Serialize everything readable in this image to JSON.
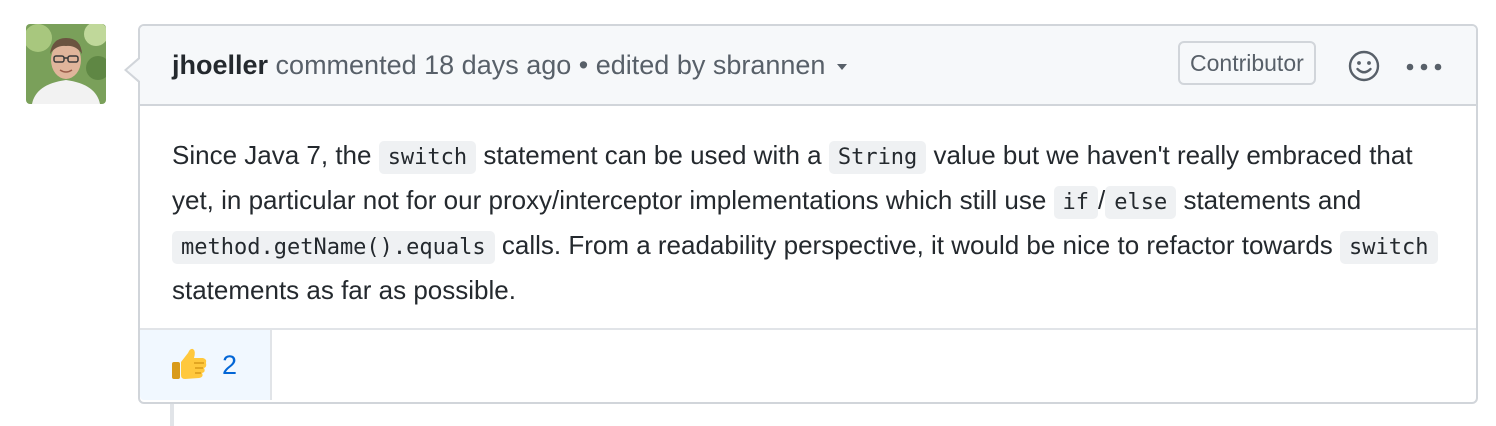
{
  "comment": {
    "author": "jhoeller",
    "action": "commented",
    "time": "18 days ago",
    "separator": "•",
    "edited_by_prefix": "edited by",
    "editor": "sbrannen",
    "role_badge": "Contributor",
    "icons": {
      "reaction": "smiley-icon",
      "more": "kebab-horizontal-icon",
      "caret": "caret-down-icon"
    },
    "body": {
      "l1_a": "Since Java 7, the ",
      "l1_code1": "switch",
      "l1_b": " statement can be used with a ",
      "l1_code2": "String",
      "l1_c": " value but we haven't really embraced that yet, in particular not for our proxy/interceptor implementations which still use ",
      "l3_code1": "if",
      "l3_slash": "/",
      "l3_code2": "else",
      "l3_a": " statements and ",
      "l3_code3": "method.getName().equals",
      "l3_b": " calls. From a readability perspective, it would be nice to refactor towards ",
      "l4_code": "switch",
      "l4_a": " statements as far as possible."
    },
    "reactions": [
      {
        "emoji": "👍",
        "icon": "thumbs-up-icon",
        "count": "2"
      }
    ]
  },
  "colors": {
    "border": "#d1d5da",
    "header_bg": "#f6f8fa",
    "link_blue": "#0366d6",
    "reaction_bg": "#f1f8ff"
  }
}
